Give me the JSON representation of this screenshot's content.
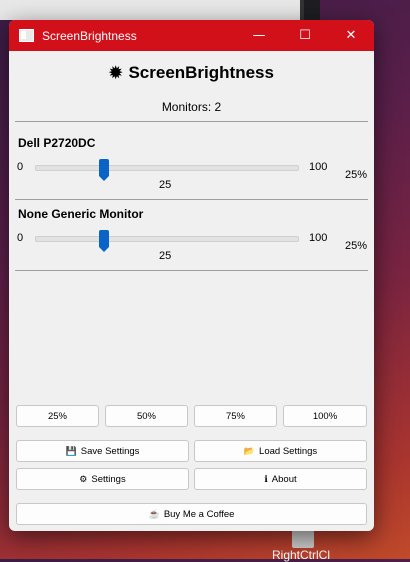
{
  "window": {
    "title": "ScreenBrightness",
    "minimize_glyph": "—",
    "maximize_glyph": "☐",
    "close_glyph": "✕"
  },
  "header": {
    "icon": "gear-icon",
    "icon_glyph": "✹",
    "title": "ScreenBrightness",
    "monitors_label": "Monitors: 2"
  },
  "monitors": [
    {
      "name": "Dell P2720DC",
      "min": "0",
      "max": "100",
      "value": "25",
      "percent": "25%",
      "level": 25
    },
    {
      "name": "None Generic Monitor",
      "min": "0",
      "max": "100",
      "value": "25",
      "percent": "25%",
      "level": 25
    }
  ],
  "presets": [
    "25%",
    "50%",
    "75%",
    "100%"
  ],
  "actions": {
    "save": {
      "label": "Save Settings",
      "icon_glyph": "💾"
    },
    "load": {
      "label": "Load Settings",
      "icon_glyph": "📂"
    },
    "settings": {
      "label": "Settings",
      "icon_glyph": "⚙"
    },
    "about": {
      "label": "About",
      "icon_glyph": "ℹ"
    },
    "coffee": {
      "label": "Buy Me a Coffee",
      "icon_glyph": "☕"
    }
  },
  "desktop": {
    "icon_label": "RightCtrlCl"
  },
  "colors": {
    "titlebar": "#d1101a",
    "slider_thumb": "#0a64c8"
  }
}
